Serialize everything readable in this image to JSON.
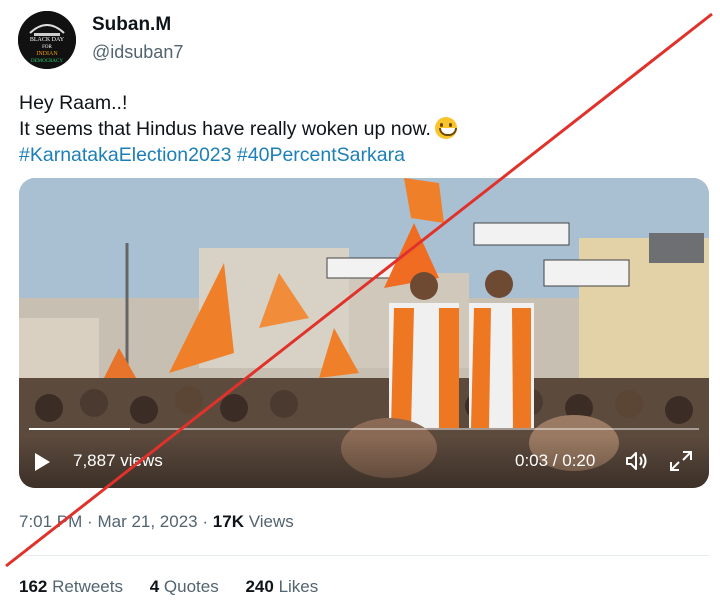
{
  "author": {
    "name": "Suban.M",
    "handle": "@idsuban7",
    "avatar_text": [
      "BLACK DAY",
      "FOR",
      "INDIAN",
      "DEMOCRACY"
    ]
  },
  "tweet": {
    "line1": "Hey Raam..!",
    "line2": "It seems that Hindus have really woken up now.",
    "emoji": "grinning-face-emoji",
    "hashtags": [
      "#KarnatakaElection2023",
      "#40PercentSarkara"
    ]
  },
  "video": {
    "views": "7,887 views",
    "time": "0:03 / 0:20",
    "progress": 0.15
  },
  "meta": {
    "time": "7:01 PM",
    "separator": "·",
    "date": "Mar 21, 2023",
    "views_count": "17K",
    "views_label": "Views"
  },
  "stats": {
    "retweets_count": "162",
    "retweets_label": "Retweets",
    "quotes_count": "4",
    "quotes_label": "Quotes",
    "likes_count": "240",
    "likes_label": "Likes"
  },
  "colors": {
    "hashtag": "#1d7fb8",
    "strike": "#e0322b",
    "secondary_text": "#536471"
  }
}
